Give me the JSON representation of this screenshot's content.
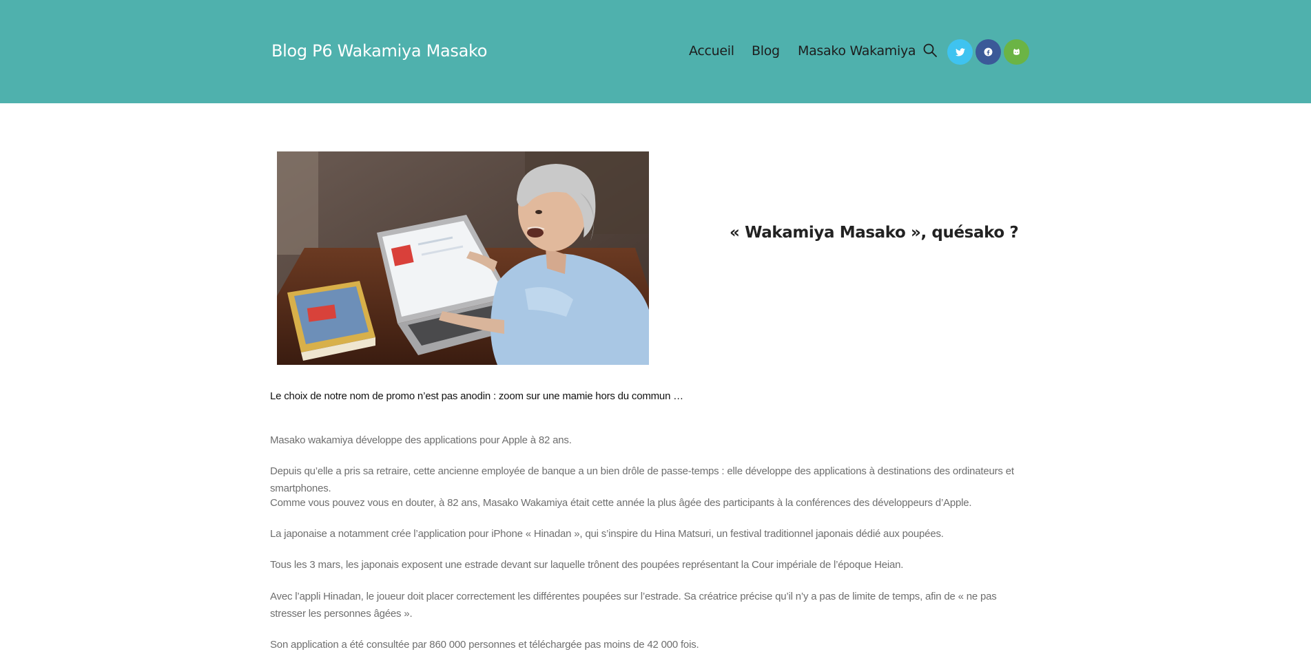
{
  "header": {
    "site_title": "Blog P6 Wakamiya Masako",
    "nav": [
      {
        "label": "Accueil"
      },
      {
        "label": "Blog"
      },
      {
        "label": "Masako Wakamiya"
      }
    ],
    "social": [
      {
        "icon": "twitter-icon",
        "color": "#3fc3f0"
      },
      {
        "icon": "facebook-icon",
        "color": "#3b5998"
      },
      {
        "icon": "github-icon",
        "color": "#6bb445"
      }
    ],
    "background": "#4fb1ad"
  },
  "post": {
    "title": "« Wakamiya Masako », quésako ?",
    "excerpt": "Le choix de notre nom de promo n’est pas anodin : zoom sur une mamie hors du commun …",
    "paragraphs": [
      "Masako wakamiya développe des applications pour Apple à 82 ans.",
      "Depuis qu’elle a pris sa retraire, cette ancienne employée de banque a un bien drôle de passe-temps : elle développe des applications à destinations des ordinateurs et smartphones.",
      "Comme vous pouvez vous en douter, à 82 ans, Masako Wakamiya était cette année la plus âgée des participants à la conférences des développeurs d’Apple.",
      "La japonaise a notamment crée l’application pour iPhone « Hinadan », qui s’inspire du Hina Matsuri, un festival traditionnel japonais dédié aux poupées.",
      "Tous les 3 mars, les japonais exposent une estrade devant sur laquelle trônent des poupées représentant la Cour impériale de l’époque Heian.",
      "Avec l’appli Hinadan, le joueur doit placer correctement les différentes poupées sur l’estrade. Sa créatrice précise qu’il n’y a pas de limite de temps, afin de « ne pas stresser les personnes âgées ».",
      "Son application a été consultée par 860 000 personnes et téléchargée pas moins de 42 000 fois."
    ]
  }
}
